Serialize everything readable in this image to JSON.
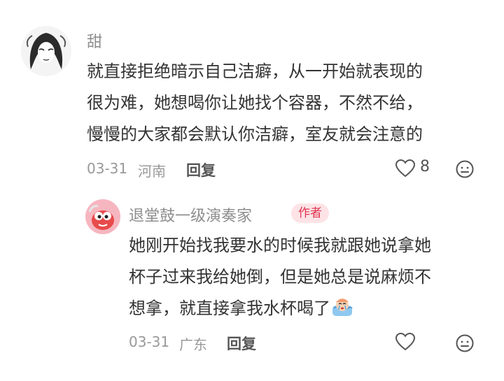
{
  "comment": {
    "username": "甜",
    "lines": [
      "就直接拒绝暗示自己洁癖，从一开始就表现的",
      "很为难，她想喝你让她找个容器，不然不给，",
      "慢慢的大家都会默认你洁癖，室友就会注意的"
    ],
    "date": "03-31",
    "location": "河南",
    "reply_label": "回复",
    "like_count": "8",
    "icons": {
      "like": "heart-outline-icon",
      "more": "emoji-face-icon"
    }
  },
  "reply": {
    "username": "退堂鼓一级演奏家",
    "badge": "作者",
    "lines": [
      "她刚开始找我要水的时候我就跟她说拿她",
      "杯子过来我给她倒，但是她总是说麻烦不",
      "想拿，就直接拿我水杯喝了"
    ],
    "date": "03-31",
    "location": "广东",
    "reply_label": "回复",
    "icons": {
      "like": "heart-outline-icon",
      "more": "emoji-face-icon",
      "inline": "crying-sticker-emoji"
    }
  },
  "colors": {
    "badge_bg": "#fde3e6",
    "badge_text": "#e0344f",
    "text": "#333333",
    "meta": "#999999"
  }
}
